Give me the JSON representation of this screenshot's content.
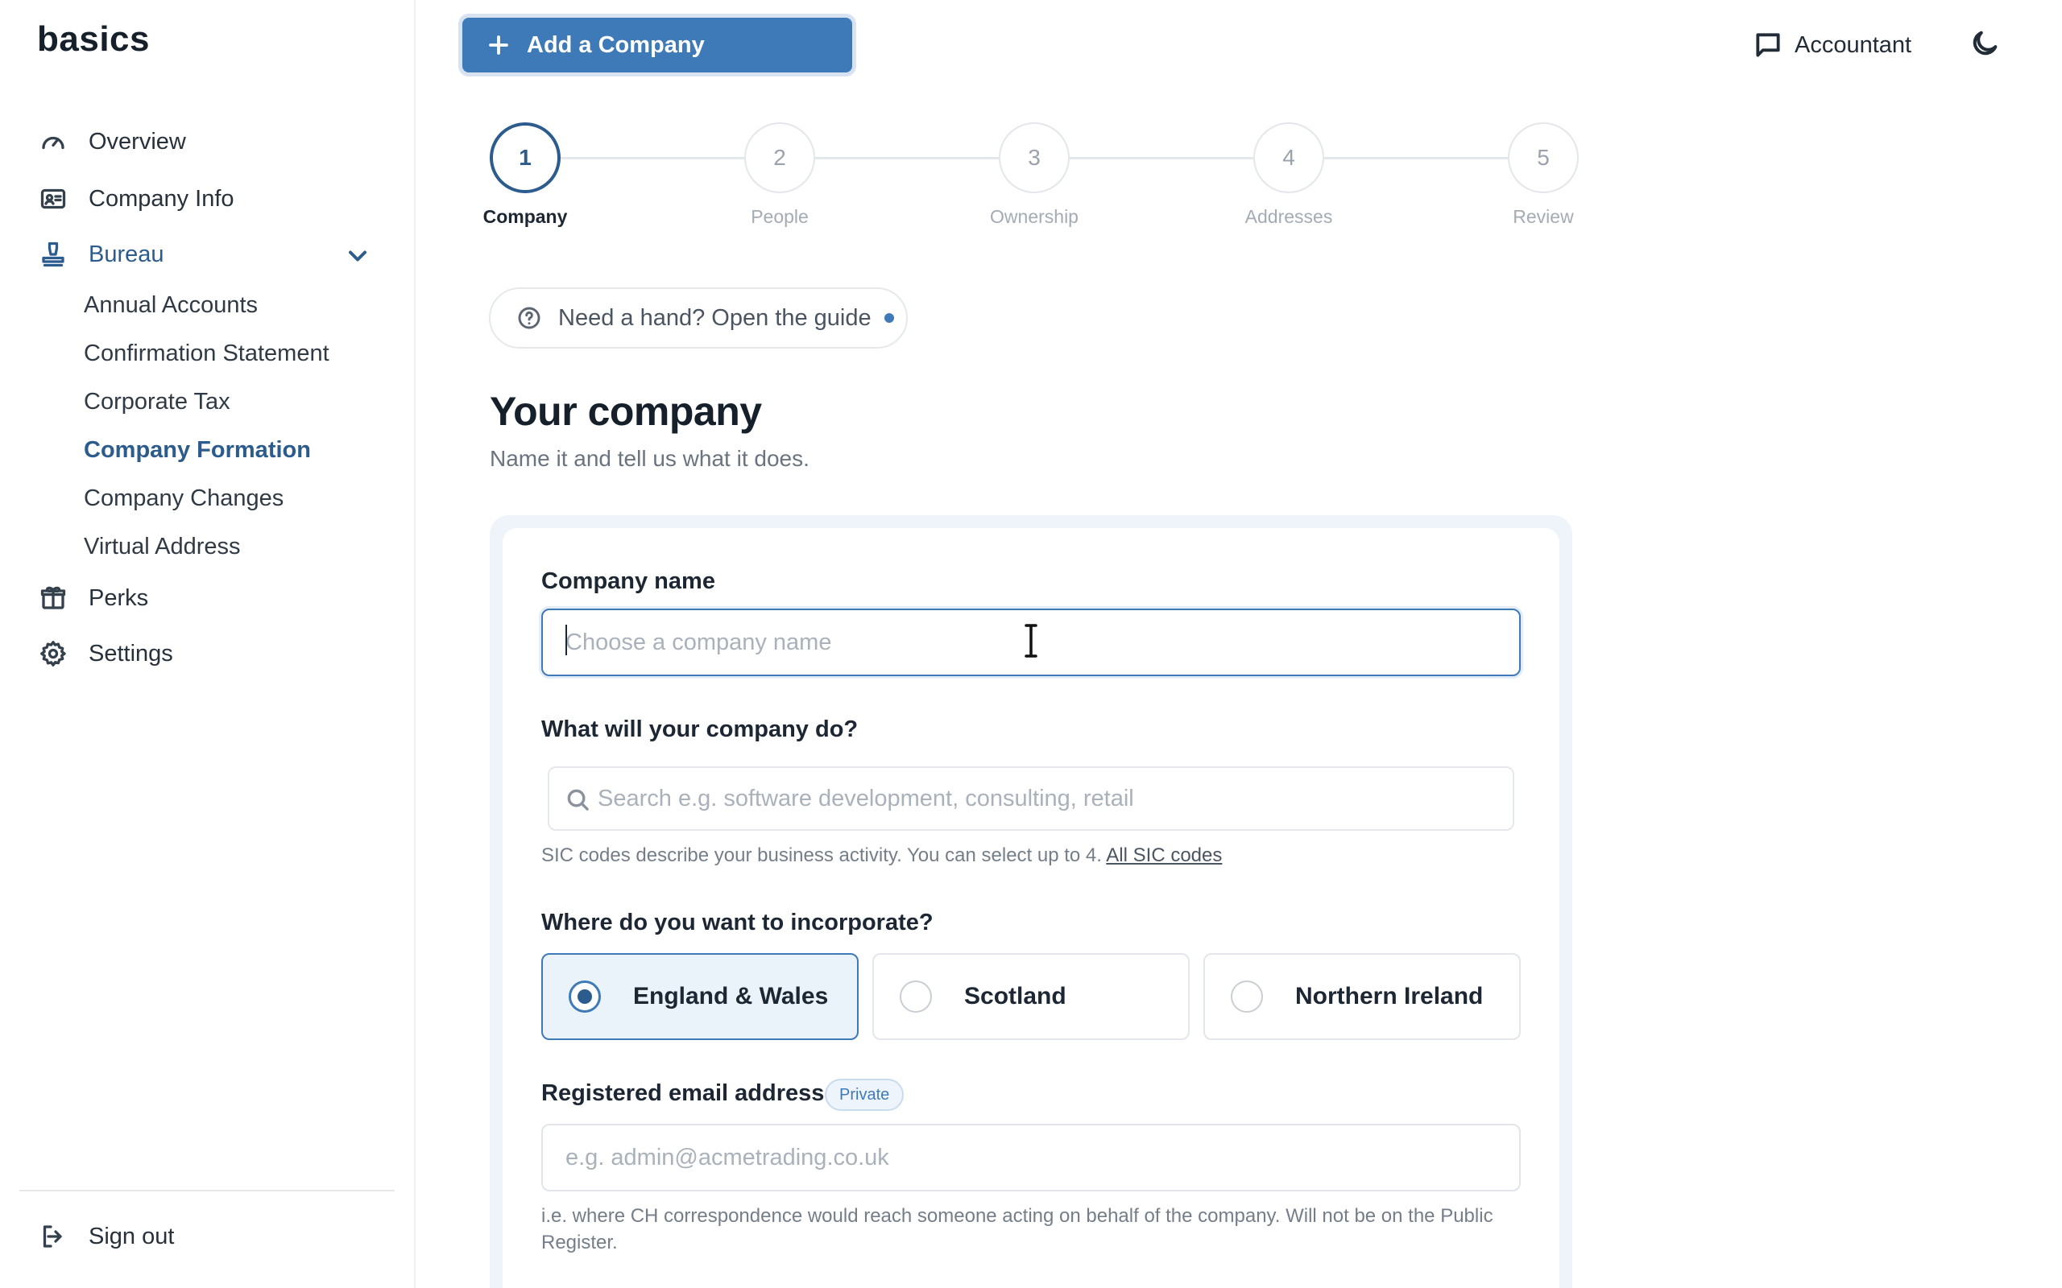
{
  "app": {
    "logo": "basics"
  },
  "sidebar": {
    "overview": "Overview",
    "company_info": "Company Info",
    "bureau": "Bureau",
    "bureau_items": [
      "Annual Accounts",
      "Confirmation Statement",
      "Corporate Tax",
      "Company Formation",
      "Company Changes",
      "Virtual Address"
    ],
    "perks": "Perks",
    "settings": "Settings",
    "sign_out": "Sign out"
  },
  "header": {
    "add_company": "Add a Company",
    "accountant": "Accountant"
  },
  "stepper": {
    "steps": [
      {
        "number": "1",
        "label": "Company"
      },
      {
        "number": "2",
        "label": "People"
      },
      {
        "number": "3",
        "label": "Ownership"
      },
      {
        "number": "4",
        "label": "Addresses"
      },
      {
        "number": "5",
        "label": "Review"
      }
    ],
    "current": 1
  },
  "guide": {
    "label": "Need a hand? Open the guide"
  },
  "page": {
    "title": "Your company",
    "subtitle": "Name it and tell us what it does."
  },
  "form": {
    "company_name": {
      "label": "Company name",
      "value": "",
      "placeholder": "Choose a company name"
    },
    "activity": {
      "label": "What will your company do?",
      "placeholder": "Search e.g. software development, consulting, retail",
      "help": "SIC codes describe your business activity. You can select up to 4.",
      "help_link": "All SIC codes"
    },
    "jurisdiction": {
      "label": "Where do you want to incorporate?",
      "options": [
        "England & Wales",
        "Scotland",
        "Northern Ireland"
      ],
      "selected": "England & Wales"
    },
    "email": {
      "label": "Registered email address",
      "badge": "Private",
      "placeholder": "e.g. admin@acmetrading.co.uk",
      "help": "i.e. where CH correspondence would reach someone acting on behalf of the company. Will not be on the Public Register."
    }
  },
  "colors": {
    "accent": "#3f7ab8",
    "accent_dark": "#2c5b8e",
    "text": "#1c2733",
    "muted": "#a9b1ba"
  }
}
